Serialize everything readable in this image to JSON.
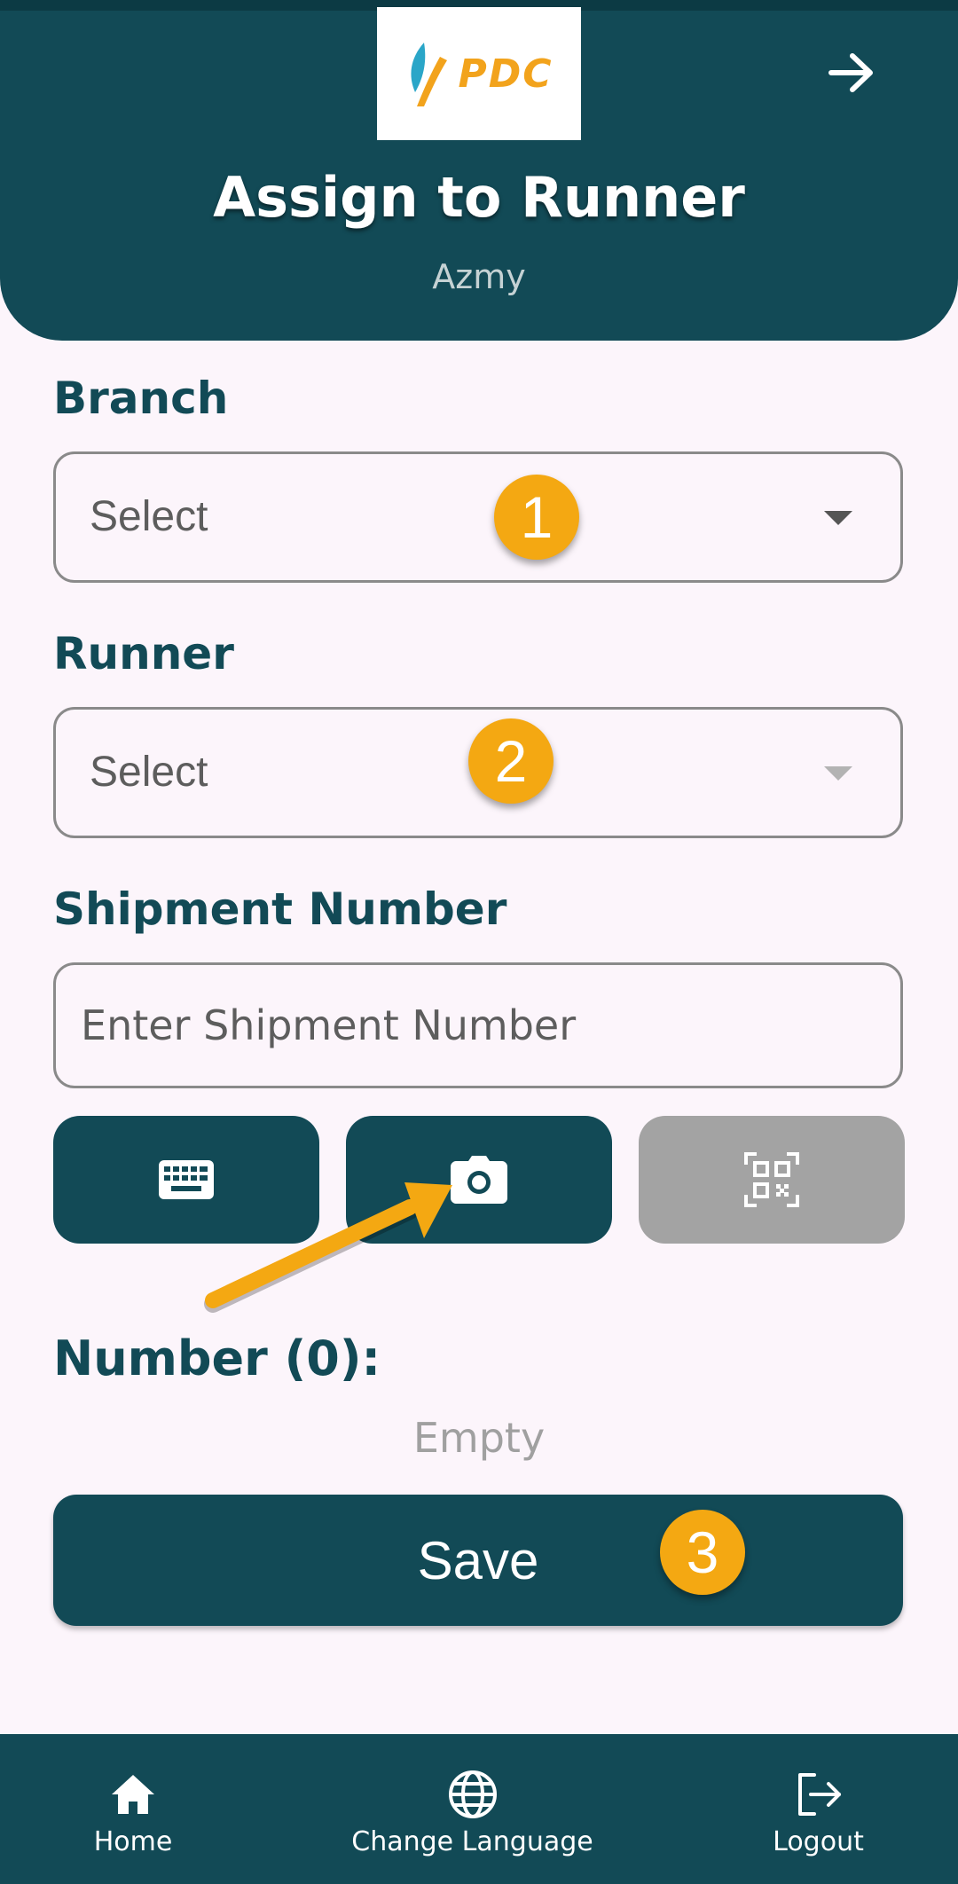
{
  "header": {
    "logo_text": "PDC",
    "title": "Assign to Runner",
    "subtitle": "Azmy",
    "back_icon": "arrow-right-icon"
  },
  "branch": {
    "label": "Branch",
    "value": "Select"
  },
  "runner": {
    "label": "Runner",
    "value": "Select"
  },
  "shipment": {
    "label": "Shipment Number",
    "placeholder": "Enter Shipment Number"
  },
  "input_modes": [
    {
      "icon": "keyboard-icon",
      "enabled": true
    },
    {
      "icon": "camera-icon",
      "enabled": true
    },
    {
      "icon": "qr-code-icon",
      "enabled": false
    }
  ],
  "numbers": {
    "label": "Number (0):",
    "empty_text": "Empty"
  },
  "save": {
    "label": "Save"
  },
  "annotations": {
    "badges": [
      "1",
      "2",
      "3"
    ]
  },
  "bottom_nav": {
    "items": [
      {
        "label": "Home",
        "icon": "home-icon"
      },
      {
        "label": "Change Language",
        "icon": "globe-icon"
      },
      {
        "label": "Logout",
        "icon": "logout-icon"
      }
    ]
  },
  "colors": {
    "primary": "#124a56",
    "background": "#fcf5fb",
    "badge": "#f4a812",
    "logo_accent": "#f2a31c",
    "disabled": "#a3a3a3"
  }
}
